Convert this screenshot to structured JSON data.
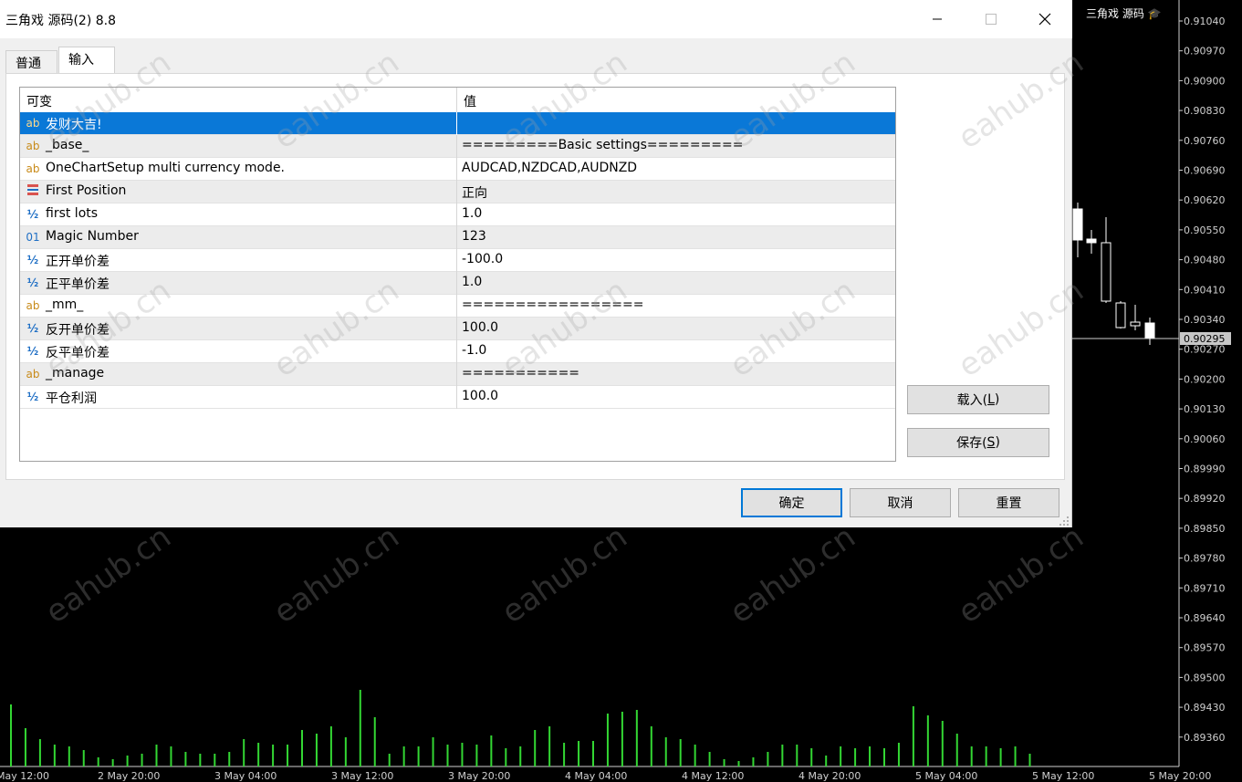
{
  "chart": {
    "symbol_title": "三角戏 源码",
    "current_price": "0.90295",
    "price_levels": [
      "0.91040",
      "0.90970",
      "0.90900",
      "0.90830",
      "0.90760",
      "0.90690",
      "0.90620",
      "0.90550",
      "0.90480",
      "0.90410",
      "0.90340",
      "0.90270",
      "0.90200",
      "0.90130",
      "0.90060",
      "0.89990",
      "0.89920",
      "0.89850",
      "0.89780",
      "0.89710",
      "0.89640",
      "0.89570",
      "0.89500",
      "0.89430",
      "0.89360"
    ],
    "time_labels": [
      "May 12:00",
      "2 May 20:00",
      "3 May 04:00",
      "3 May 12:00",
      "3 May 20:00",
      "4 May 04:00",
      "4 May 12:00",
      "4 May 20:00",
      "5 May 04:00",
      "5 May 12:00",
      "5 May 20:00"
    ],
    "volume_color": "#33d733",
    "watermark": "eahub.cn"
  },
  "dialog": {
    "title": "三角戏 源码(2) 8.8",
    "tabs": [
      "普通",
      "输入"
    ],
    "active_tab": "输入",
    "columns": {
      "name": "可变",
      "value": "值"
    },
    "rows": [
      {
        "icon": "ab",
        "name": "发财大吉!",
        "value": ""
      },
      {
        "icon": "ab",
        "name": "_base_",
        "value": "=========Basic settings========="
      },
      {
        "icon": "ab",
        "name": "OneChartSetup multi currency mode.",
        "value": "AUDCAD,NZDCAD,AUDNZD"
      },
      {
        "icon": "enum",
        "name": "First Position",
        "value": "正向"
      },
      {
        "icon": "half",
        "name": "first lots",
        "value": "1.0"
      },
      {
        "icon": "01",
        "name": "Magic Number",
        "value": "123"
      },
      {
        "icon": "half",
        "name": "正开单价差",
        "value": "-100.0"
      },
      {
        "icon": "half",
        "name": "正平单价差",
        "value": "1.0"
      },
      {
        "icon": "ab",
        "name": "_mm_",
        "value": "================="
      },
      {
        "icon": "half",
        "name": "反开单价差",
        "value": "100.0"
      },
      {
        "icon": "half",
        "name": "反平单价差",
        "value": "-1.0"
      },
      {
        "icon": "ab",
        "name": "_manage",
        "value": "==========="
      },
      {
        "icon": "half",
        "name": "平仓利润",
        "value": "100.0"
      }
    ],
    "buttons": {
      "load": {
        "label": "载入(",
        "key": "L",
        "end": ")"
      },
      "save": {
        "label": "保存(",
        "key": "S",
        "end": ")"
      },
      "ok": "确定",
      "cancel": "取消",
      "reset": "重置"
    }
  }
}
